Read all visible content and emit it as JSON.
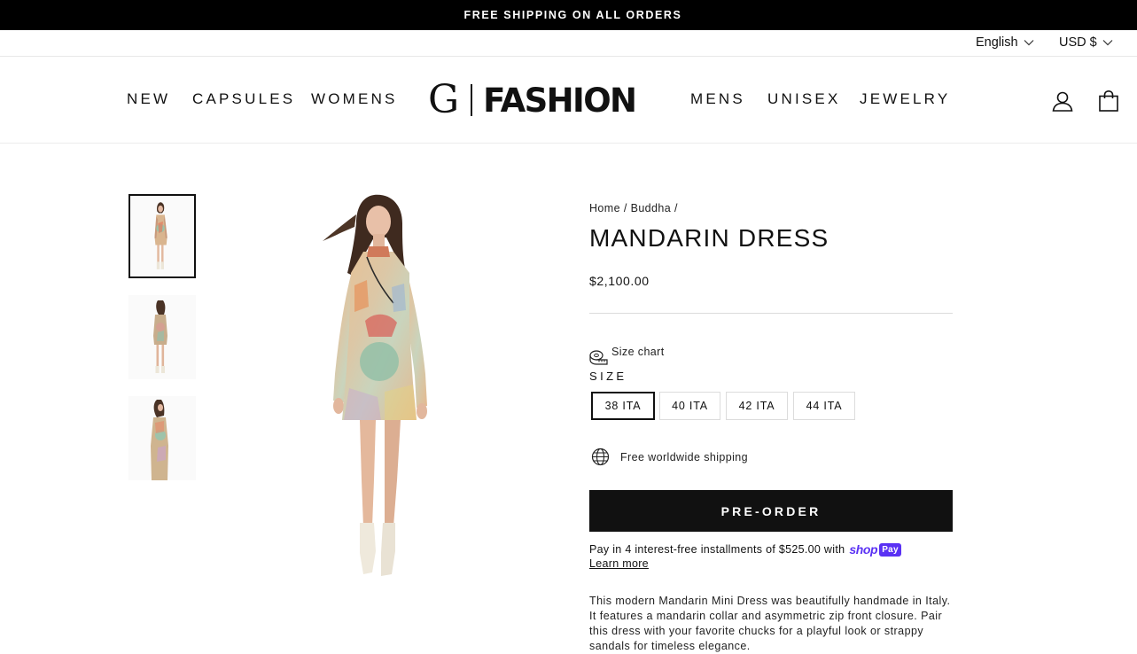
{
  "announcement": {
    "text": "FREE SHIPPING ON ALL ORDERS"
  },
  "utility": {
    "language": "English",
    "currency": "USD $"
  },
  "nav": {
    "left": [
      {
        "label": "NEW"
      },
      {
        "label": "CAPSULES"
      },
      {
        "label": "WOMENS"
      }
    ],
    "right": [
      {
        "label": "MENS"
      },
      {
        "label": "UNISEX"
      },
      {
        "label": "JEWELRY"
      }
    ]
  },
  "logo": {
    "mark": "G",
    "word": "FASHION"
  },
  "header_icons": {
    "account": "user-icon",
    "cart": "bag-icon"
  },
  "product": {
    "breadcrumb": {
      "home": "Home",
      "sep": "/",
      "collection": "Buddha"
    },
    "title": "MANDARIN DRESS",
    "price": "$2,100.00",
    "size_chart_label": "Size chart",
    "size_label": "SIZE",
    "sizes": [
      "38 ITA",
      "40 ITA",
      "42 ITA",
      "44 ITA"
    ],
    "selected_size": "38 ITA",
    "shipping_note": "Free worldwide shipping",
    "button_label": "PRE-ORDER",
    "installments_text": "Pay in 4 interest-free installments of $525.00 with",
    "shop_pay": {
      "shop": "shop",
      "pay": "Pay"
    },
    "learn_more": "Learn more",
    "description": "This modern Mandarin Mini Dress was beautifully handmade in Italy. It features a mandarin collar and asymmetric zip front closure. Pair this dress with your favorite chucks for a playful look or strappy sandals for timeless elegance."
  },
  "colors": {
    "announcement_bg": "#000000",
    "button_bg": "#111111",
    "shop_pay_purple": "#5a31f4",
    "divider": "#dcdcdc"
  }
}
